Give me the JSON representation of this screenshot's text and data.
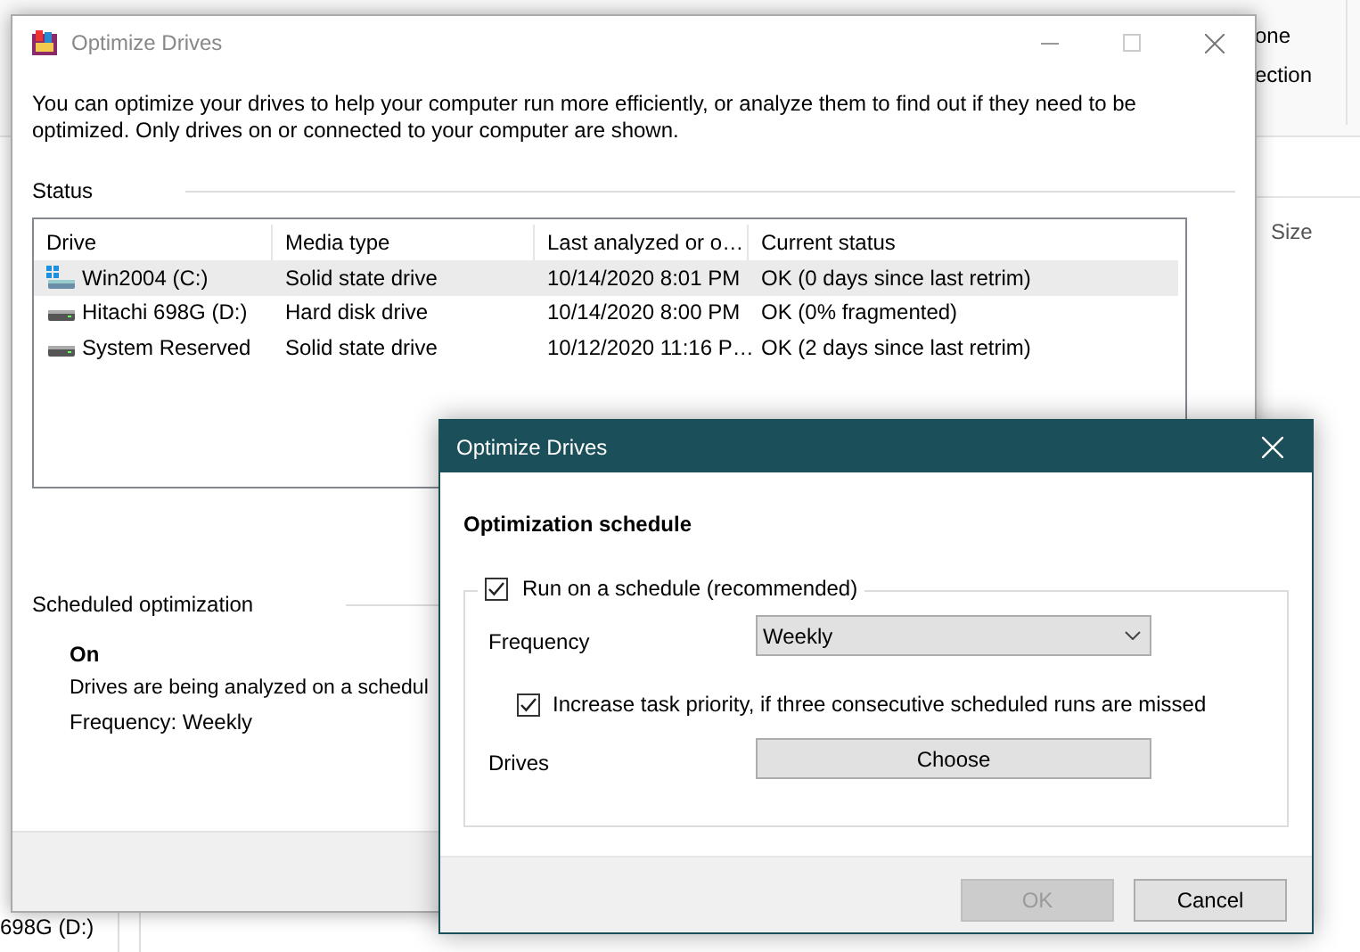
{
  "background": {
    "ribbon_texts": [
      "one",
      "ection"
    ],
    "column_header": "Size",
    "drive_item": "698G (D:)"
  },
  "main_window": {
    "title": "Optimize Drives",
    "description": "You can optimize your drives to help your computer run more efficiently, or analyze them to find out if they need to be optimized. Only drives on or connected to your computer are shown.",
    "status_label": "Status",
    "table": {
      "columns": [
        "Drive",
        "Media type",
        "Last analyzed or o…",
        "Current status"
      ],
      "rows": [
        {
          "drive": "Win2004 (C:)",
          "kind": "system",
          "media_type": "Solid state drive",
          "last_analyzed": "10/14/2020 8:01 PM",
          "status": "OK (0 days since last retrim)",
          "selected": true
        },
        {
          "drive": "Hitachi 698G (D:)",
          "kind": "disk",
          "media_type": "Hard disk drive",
          "last_analyzed": "10/14/2020 8:00 PM",
          "status": "OK (0% fragmented)",
          "selected": false
        },
        {
          "drive": "System Reserved",
          "kind": "disk",
          "media_type": "Solid state drive",
          "last_analyzed": "10/12/2020 11:16 P…",
          "status": "OK (2 days since last retrim)",
          "selected": false
        }
      ]
    },
    "scheduled": {
      "label": "Scheduled optimization",
      "state": "On",
      "description": "Drives are being analyzed on a schedul",
      "frequency": "Frequency: Weekly"
    }
  },
  "dialog": {
    "title": "Optimize Drives",
    "heading": "Optimization schedule",
    "run_on_schedule": {
      "label": "Run on a schedule (recommended)",
      "checked": true
    },
    "frequency": {
      "label": "Frequency",
      "value": "Weekly"
    },
    "increase_priority": {
      "label": "Increase task priority, if three consecutive scheduled runs are missed",
      "checked": true
    },
    "drives": {
      "label": "Drives",
      "button": "Choose"
    },
    "buttons": [
      {
        "label": "OK",
        "disabled": true
      },
      {
        "label": "Cancel",
        "disabled": false
      }
    ]
  }
}
